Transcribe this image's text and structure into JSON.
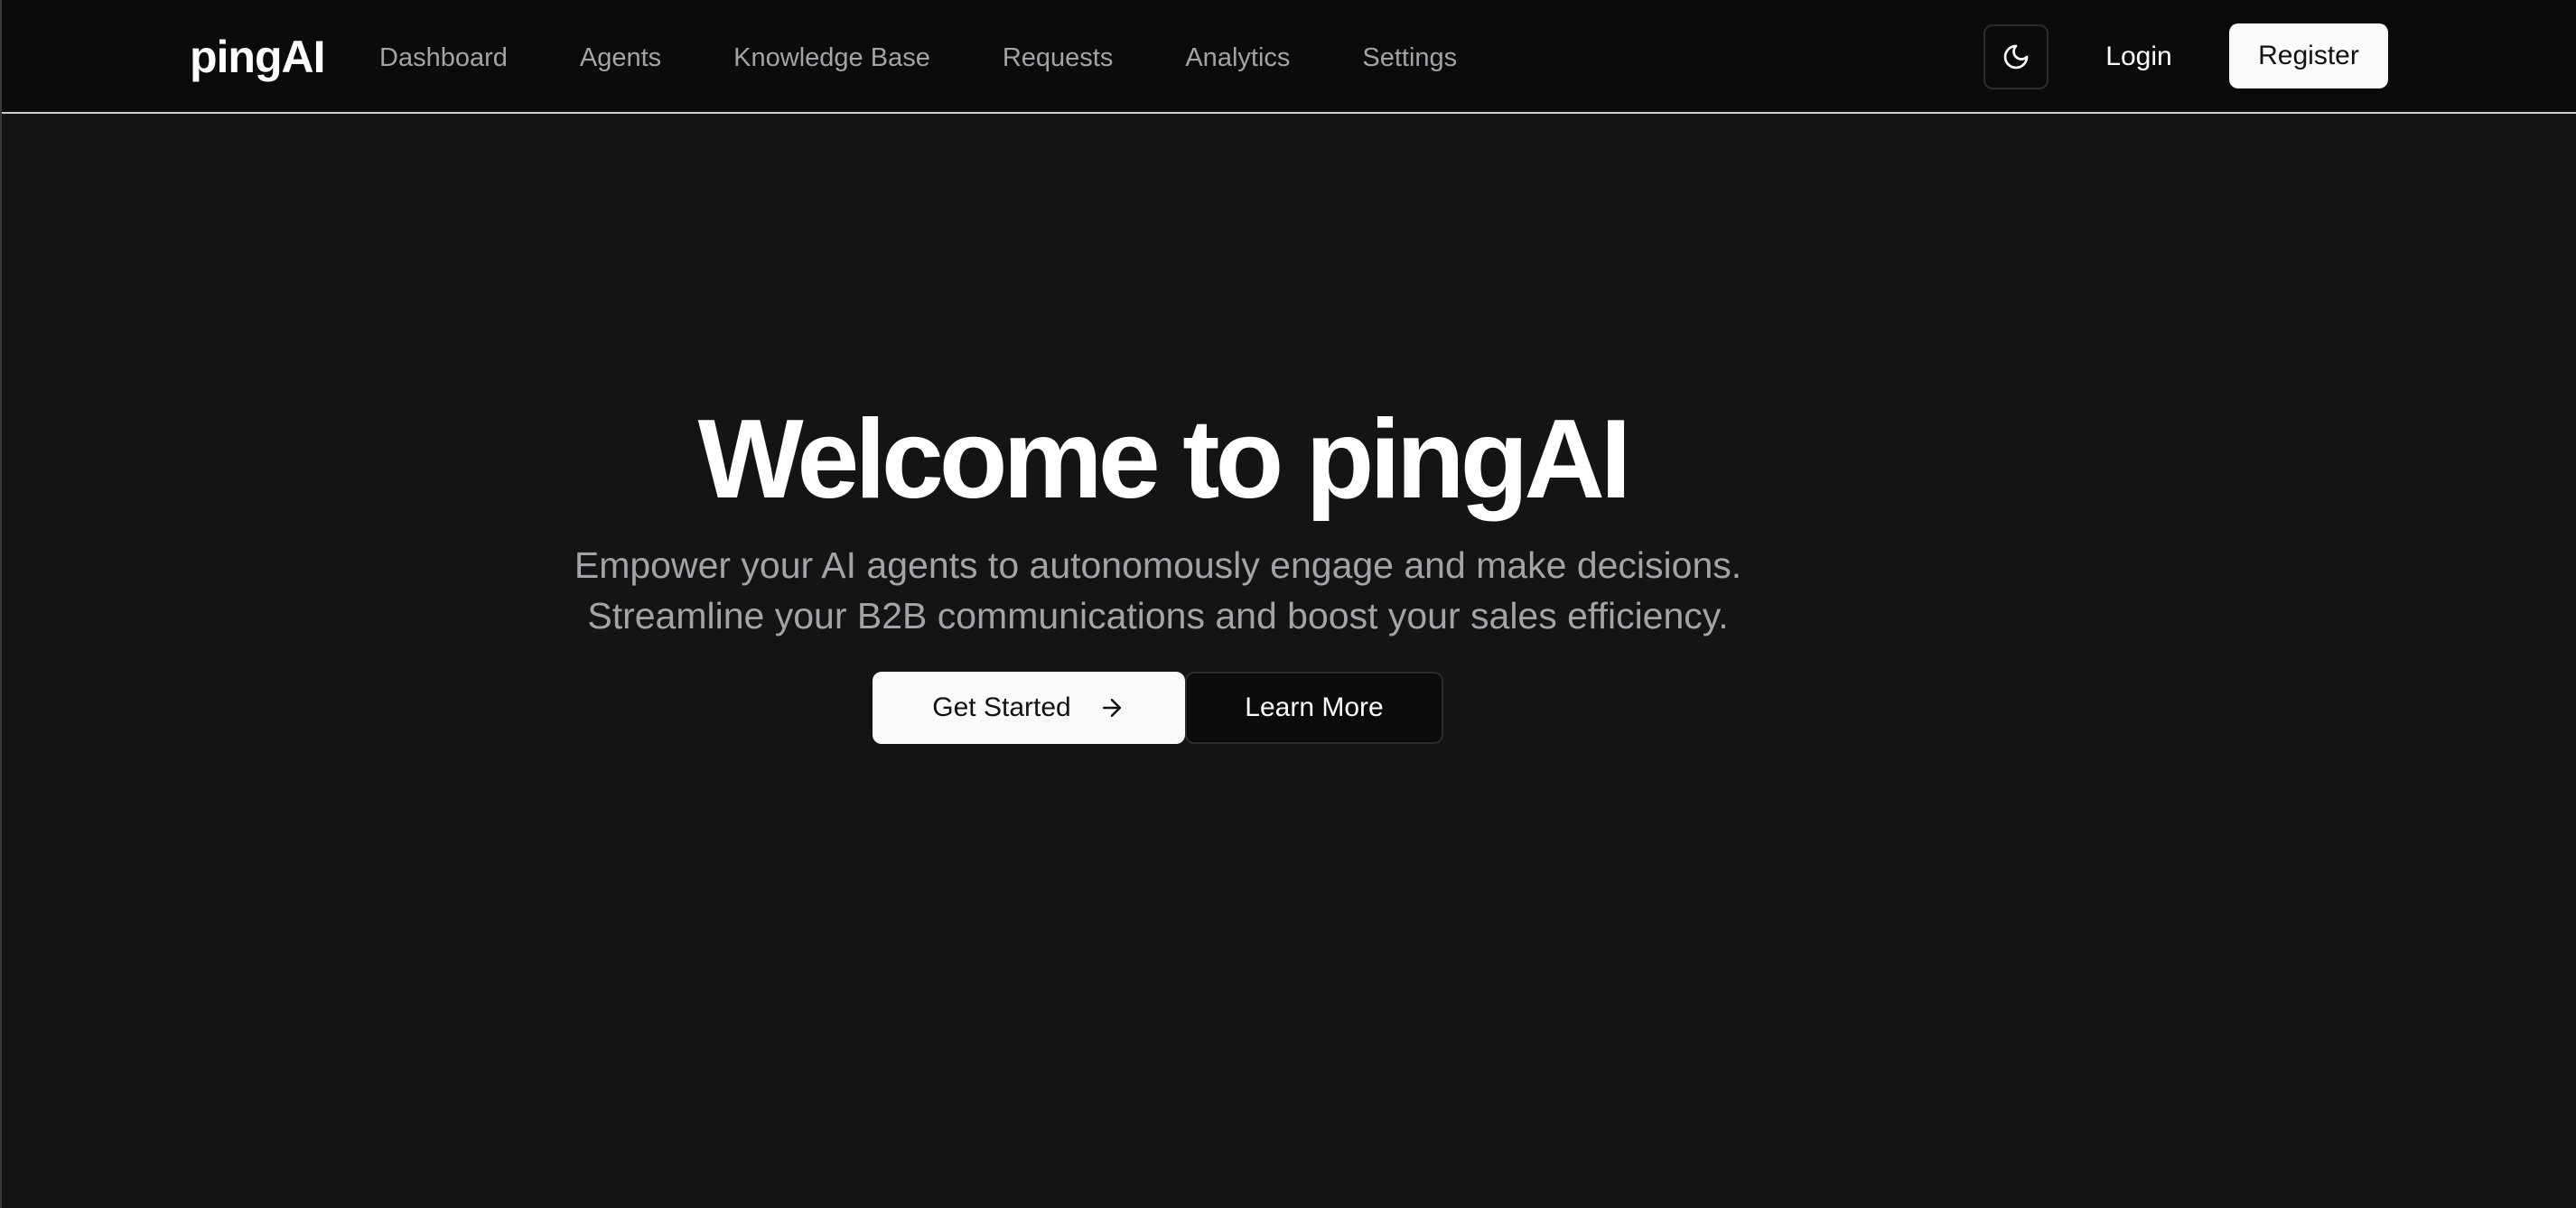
{
  "header": {
    "brand": "pingAI",
    "nav": [
      {
        "label": "Dashboard"
      },
      {
        "label": "Agents"
      },
      {
        "label": "Knowledge Base"
      },
      {
        "label": "Requests"
      },
      {
        "label": "Analytics"
      },
      {
        "label": "Settings"
      }
    ],
    "theme_toggle_icon": "moon-icon",
    "login_label": "Login",
    "register_label": "Register"
  },
  "hero": {
    "title": "Welcome to pingAI",
    "subtitle_line1": "Empower your AI agents to autonomously engage and make decisions.",
    "subtitle_line2": "Streamline your B2B communications and boost your sales efficiency.",
    "primary_button_label": "Get Started",
    "primary_button_icon": "arrow-right-icon",
    "secondary_button_label": "Learn More"
  },
  "colors": {
    "background": "#141414",
    "header_background": "#0b0b0c",
    "muted_text": "#a3a3a8",
    "primary_button": "#fafafa"
  }
}
